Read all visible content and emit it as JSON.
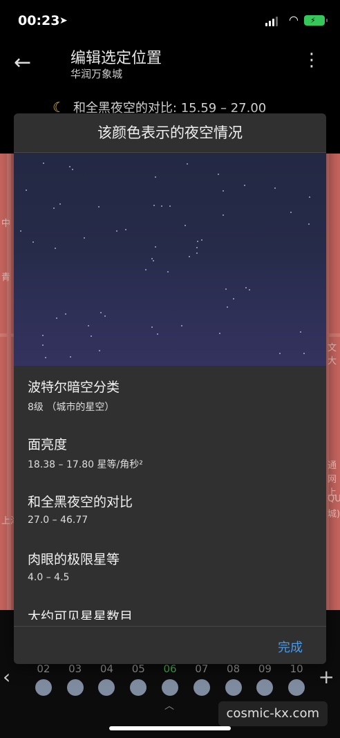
{
  "status_bar": {
    "time": "00:23",
    "location_icon": "location-arrow-icon",
    "battery_icon": "battery-charging-icon"
  },
  "app_bar": {
    "title": "编辑选定位置",
    "subtitle": "华润万象城",
    "back_icon": "back-arrow-icon",
    "menu_icon": "more-vertical-icon"
  },
  "contrast_line": {
    "icon": "moon-stars-icon",
    "text": "和全黑夜空的对比:  15.59 – 27.00"
  },
  "dialog": {
    "title": "该颜色表示的夜空情况",
    "items": [
      {
        "label": "波特尔暗空分类",
        "value": "8级 （城市的星空）"
      },
      {
        "label": "面亮度",
        "value": "18.38 – 17.80 星等/角秒²"
      },
      {
        "label": "和全黑夜空的对比",
        "value": "27.0 – 46.77"
      },
      {
        "label": "肉眼的极限星等",
        "value": "4.0 – 4.5"
      },
      {
        "label": "大约可见星星数目",
        "value": ""
      }
    ],
    "done_label": "完成"
  },
  "timeline": {
    "hours": [
      "02",
      "03",
      "04",
      "05",
      "06",
      "07",
      "08",
      "09",
      "10"
    ],
    "active_hour": "06"
  },
  "watermark": "cosmic-kx.com",
  "colors": {
    "map": "#c96660",
    "dialog_bg": "#303030",
    "accent": "#4a9ae8",
    "active_hour": "#4caf50"
  }
}
